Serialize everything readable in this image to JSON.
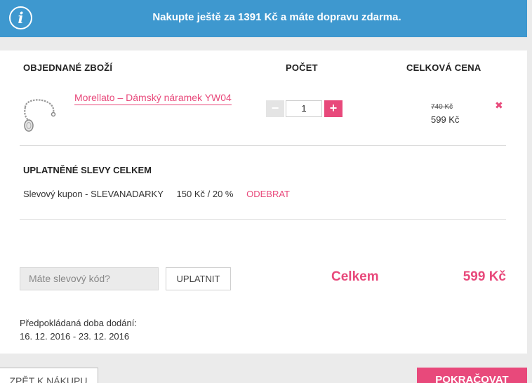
{
  "banner": {
    "icon": "info-icon",
    "message": "Nakupte ještě za 1391 Kč a máte dopravu zdarma."
  },
  "table": {
    "headers": {
      "item": "OBJEDNANÉ ZBOŽÍ",
      "quantity": "POČET",
      "total": "CELKOVÁ CENA"
    },
    "rows": [
      {
        "name": "Morellato – Dámský náramek YW04",
        "quantity": "1",
        "old_price": "740 Kč",
        "price": "599 Kč",
        "remove_icon": "✖"
      }
    ]
  },
  "discounts": {
    "title": "UPLATNĚNÉ SLEVY CELKEM",
    "items": [
      {
        "label": "Slevový kupon - SLEVANADARKY",
        "amount": "150 Kč / 20 %",
        "remove": "ODEBRAT"
      }
    ]
  },
  "coupon": {
    "placeholder": "Máte slevový kód?",
    "apply_label": "UPLATNIT"
  },
  "summary": {
    "total_label": "Celkem",
    "total_value": "599 Kč"
  },
  "delivery": {
    "label": "Předpokládaná doba dodání:",
    "date": "16. 12. 2016 - 23. 12. 2016"
  },
  "footer": {
    "back_label": "ZPĚT K NÁKUPU",
    "next_label": "POKRAČOVAT"
  },
  "colors": {
    "banner": "#3e98cf",
    "accent": "#e8497b",
    "page_bg": "#ebebeb"
  }
}
